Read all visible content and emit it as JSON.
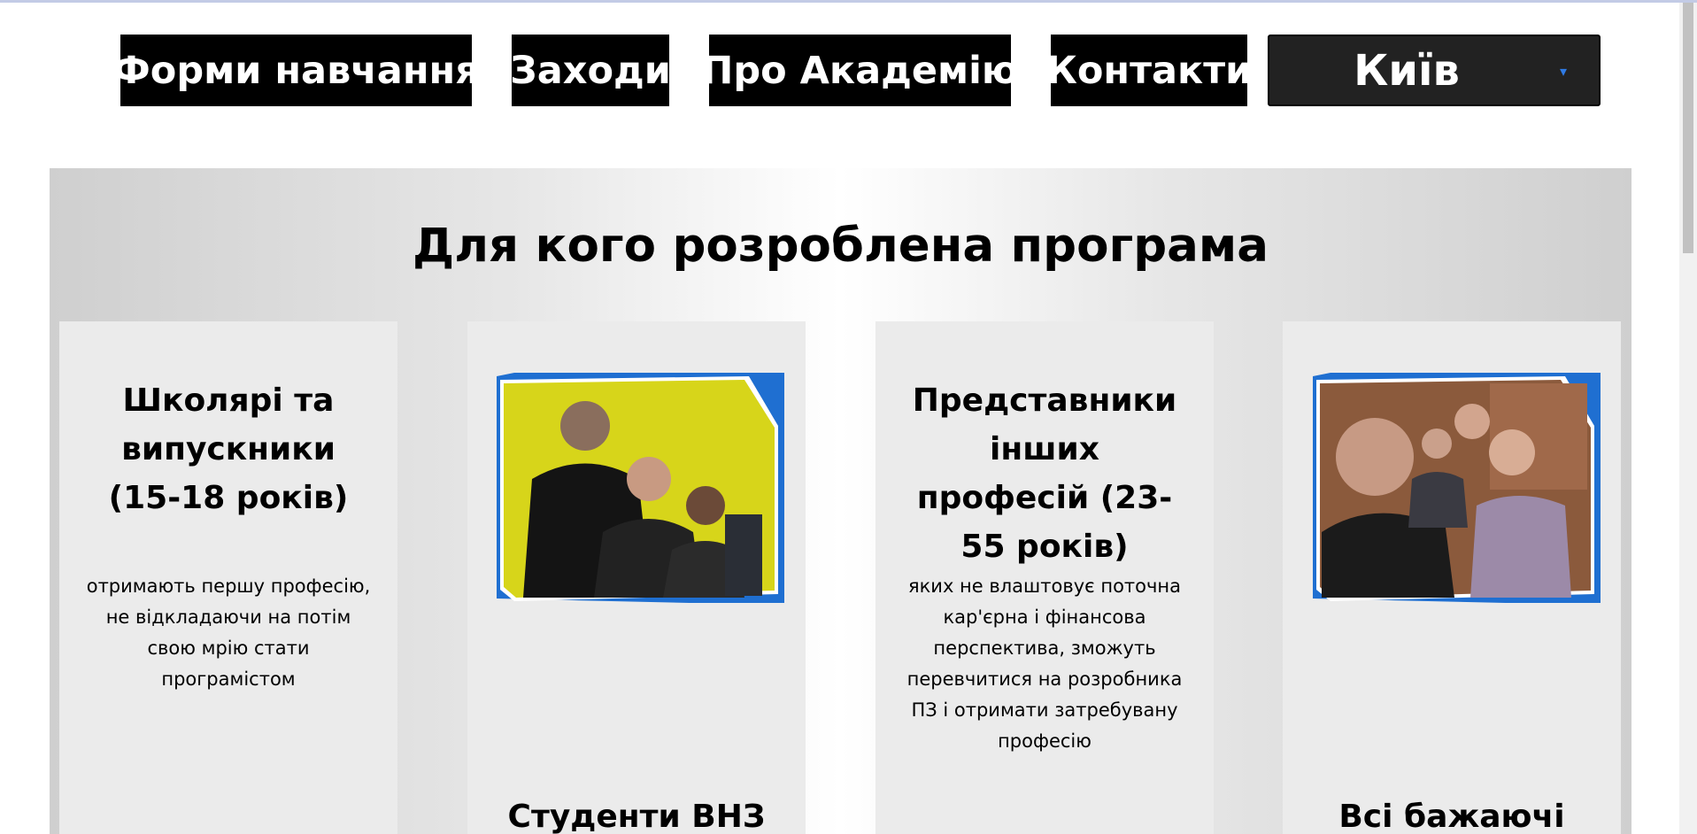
{
  "nav": {
    "items": [
      {
        "label": "Форми навчання"
      },
      {
        "label": "Заходи"
      },
      {
        "label": "Про Академію"
      },
      {
        "label": "Контакти"
      }
    ],
    "city_select": {
      "value": "Київ"
    }
  },
  "section": {
    "title": "Для кого розроблена програма",
    "cards": [
      {
        "title": "Школярі та випускники (15-18 років)",
        "text": "отримають першу професію, не відкладаючи на потім свою мрію стати програмістом"
      },
      {
        "title": "Студенти ВНЗ"
      },
      {
        "title": "Представники інших професій (23-55 років)",
        "text": "яких не влаштовує поточна кар'єрна і фінансова перспектива, зможуть перевчитися на розробника ПЗ і отримати затребувану професію"
      },
      {
        "title": "Всі бажаючі"
      }
    ]
  },
  "colors": {
    "accent": "#1f6fd1",
    "nav_bg": "#000000",
    "card_bg": "#ebebeb",
    "caret": "#2f7be5"
  }
}
